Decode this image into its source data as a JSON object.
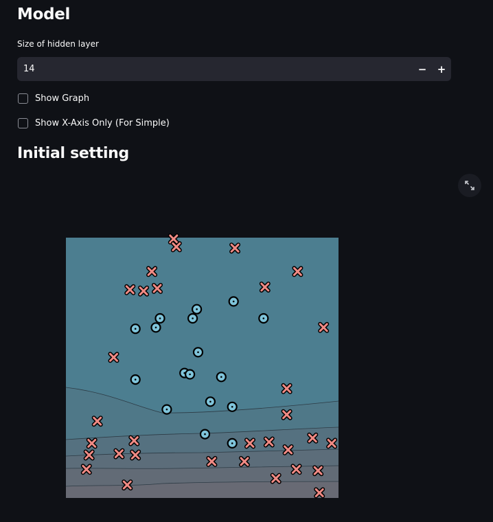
{
  "model": {
    "heading": "Model",
    "hidden_layer_label": "Size of hidden layer",
    "hidden_layer_value": "14",
    "minus_label": "−",
    "plus_label": "+"
  },
  "options": {
    "show_graph_label": "Show Graph",
    "show_graph_checked": false,
    "show_x_axis_label": "Show X-Axis Only (For Simple)",
    "show_x_axis_checked": false
  },
  "initial": {
    "heading": "Initial setting",
    "expand_icon": "fullscreen-icon"
  },
  "colors": {
    "background": "#0f1116",
    "input_bg": "#262730",
    "class_x": "#f08a84",
    "class_o": "#7fc4da",
    "region_top": "#4d8092",
    "region_bottom": "#6e6e78"
  },
  "chart_data": {
    "type": "scatter",
    "title": "",
    "xlabel": "",
    "ylabel": "",
    "xlim": [
      0,
      100
    ],
    "ylim": [
      0,
      100
    ],
    "grid": false,
    "legend": "none",
    "series": [
      {
        "marker": "x",
        "color": "#f08a84",
        "points": [
          [
            39.5,
            99.5
          ],
          [
            40.5,
            96.5
          ],
          [
            62.0,
            96.0
          ],
          [
            31.5,
            87.0
          ],
          [
            85.0,
            87.0
          ],
          [
            73.0,
            81.0
          ],
          [
            23.5,
            80.0
          ],
          [
            28.5,
            79.5
          ],
          [
            33.5,
            80.5
          ],
          [
            94.5,
            65.5
          ],
          [
            17.5,
            54.0
          ],
          [
            81.0,
            42.0
          ],
          [
            81.0,
            32.0
          ],
          [
            11.5,
            29.5
          ],
          [
            9.5,
            21.0
          ],
          [
            25.0,
            22.0
          ],
          [
            67.5,
            21.0
          ],
          [
            74.5,
            21.5
          ],
          [
            90.5,
            23.0
          ],
          [
            97.5,
            21.0
          ],
          [
            8.5,
            16.5
          ],
          [
            19.5,
            17.0
          ],
          [
            25.5,
            16.5
          ],
          [
            81.5,
            18.5
          ],
          [
            53.5,
            14.0
          ],
          [
            65.5,
            14.0
          ],
          [
            7.5,
            11.0
          ],
          [
            84.5,
            11.0
          ],
          [
            92.5,
            10.5
          ],
          [
            77.0,
            7.5
          ],
          [
            22.5,
            5.0
          ],
          [
            93.0,
            2.0
          ]
        ]
      },
      {
        "marker": "o",
        "color": "#7fc4da",
        "points": [
          [
            61.5,
            75.5
          ],
          [
            48.0,
            72.5
          ],
          [
            46.5,
            69.0
          ],
          [
            34.5,
            69.0
          ],
          [
            72.5,
            69.0
          ],
          [
            25.5,
            65.0
          ],
          [
            33.0,
            65.5
          ],
          [
            48.5,
            56.0
          ],
          [
            43.5,
            48.0
          ],
          [
            45.5,
            47.5
          ],
          [
            57.0,
            46.5
          ],
          [
            25.5,
            45.5
          ],
          [
            53.0,
            37.0
          ],
          [
            61.0,
            35.0
          ],
          [
            37.0,
            34.0
          ],
          [
            51.0,
            24.5
          ],
          [
            61.0,
            21.0
          ]
        ]
      }
    ]
  }
}
